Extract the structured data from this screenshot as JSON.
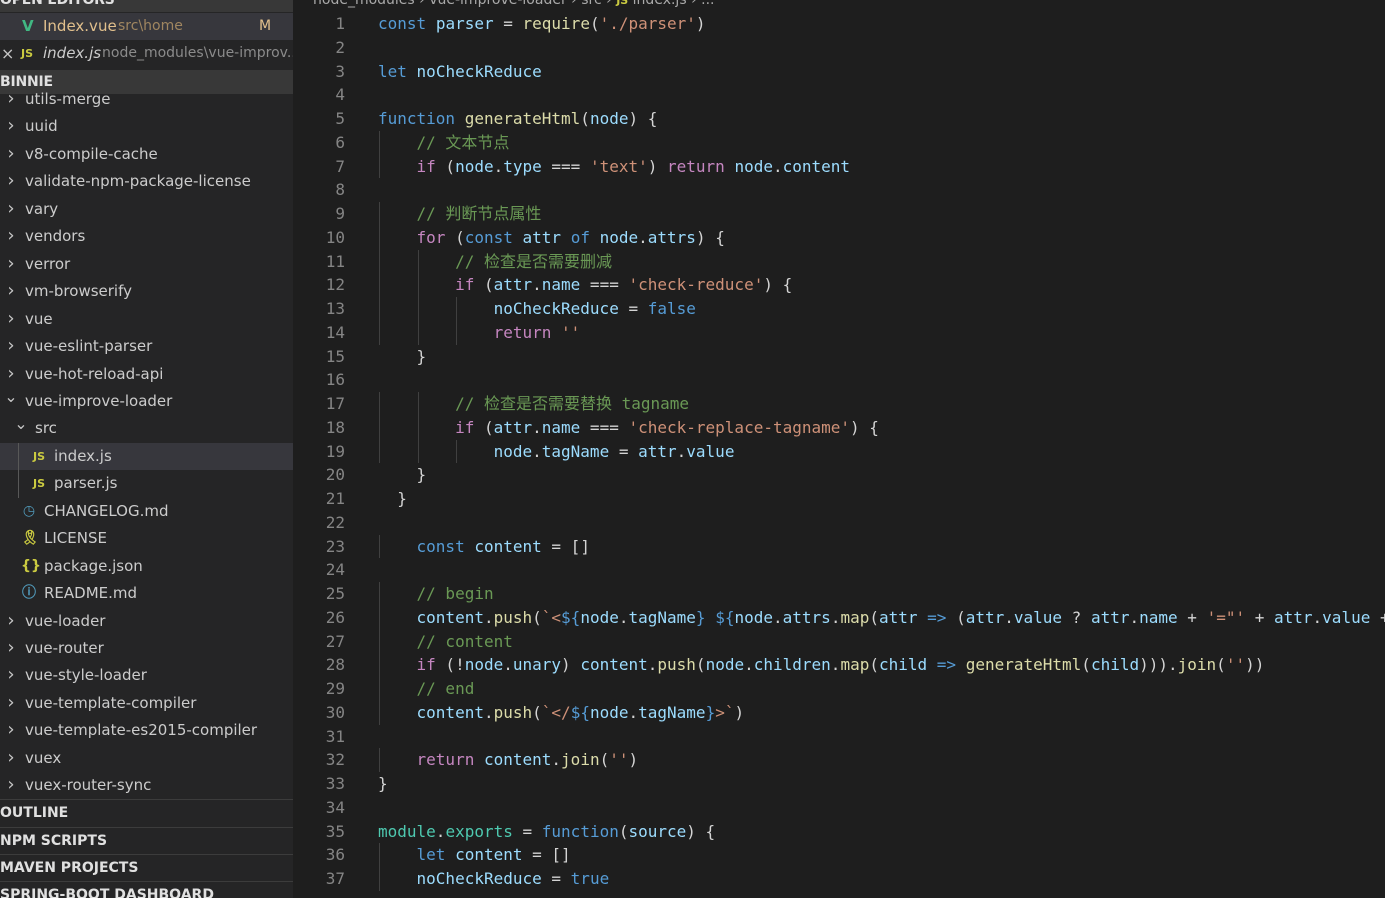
{
  "sidebar": {
    "open_editors_header": "OPEN EDITORS",
    "open_editors": [
      {
        "name": "Index.vue",
        "path": "src\\home",
        "status": "M",
        "icon": "vue-icon"
      },
      {
        "name": "index.js",
        "path": "node_modules\\vue-improv...",
        "icon": "js-icon",
        "close": "×"
      }
    ],
    "explorer_header": "BINNIE",
    "tree": [
      {
        "label": "utils-merge",
        "type": "folder",
        "expanded": false
      },
      {
        "label": "uuid",
        "type": "folder",
        "expanded": false
      },
      {
        "label": "v8-compile-cache",
        "type": "folder",
        "expanded": false
      },
      {
        "label": "validate-npm-package-license",
        "type": "folder",
        "expanded": false
      },
      {
        "label": "vary",
        "type": "folder",
        "expanded": false
      },
      {
        "label": "vendors",
        "type": "folder",
        "expanded": false
      },
      {
        "label": "verror",
        "type": "folder",
        "expanded": false
      },
      {
        "label": "vm-browserify",
        "type": "folder",
        "expanded": false
      },
      {
        "label": "vue",
        "type": "folder",
        "expanded": false
      },
      {
        "label": "vue-eslint-parser",
        "type": "folder",
        "expanded": false
      },
      {
        "label": "vue-hot-reload-api",
        "type": "folder",
        "expanded": false
      },
      {
        "label": "vue-improve-loader",
        "type": "folder",
        "expanded": true
      },
      {
        "label": "src",
        "type": "folder",
        "expanded": true
      },
      {
        "label": "index.js",
        "type": "file",
        "icon": "js-icon",
        "icon_text": "JS",
        "icon_color": "#cbcb41"
      },
      {
        "label": "parser.js",
        "type": "file",
        "icon": "js-icon",
        "icon_text": "JS",
        "icon_color": "#cbcb41"
      },
      {
        "label": "CHANGELOG.md",
        "type": "file",
        "icon": "clock-icon",
        "icon_text": "◷",
        "icon_color": "#519aba"
      },
      {
        "label": "LICENSE",
        "type": "file",
        "icon": "license-icon",
        "icon_text": "🎗",
        "icon_color": "#cbcb41"
      },
      {
        "label": "package.json",
        "type": "file",
        "icon": "braces-icon",
        "icon_text": "{}",
        "icon_color": "#cbcb41"
      },
      {
        "label": "README.md",
        "type": "file",
        "icon": "info-icon",
        "icon_text": "ⓘ",
        "icon_color": "#519aba"
      },
      {
        "label": "vue-loader",
        "type": "folder",
        "expanded": false
      },
      {
        "label": "vue-router",
        "type": "folder",
        "expanded": false
      },
      {
        "label": "vue-style-loader",
        "type": "folder",
        "expanded": false
      },
      {
        "label": "vue-template-compiler",
        "type": "folder",
        "expanded": false
      },
      {
        "label": "vue-template-es2015-compiler",
        "type": "folder",
        "expanded": false
      },
      {
        "label": "vuex",
        "type": "folder",
        "expanded": false
      },
      {
        "label": "vuex-router-sync",
        "type": "folder",
        "expanded": false
      }
    ],
    "panels": [
      "OUTLINE",
      "NPM SCRIPTS",
      "MAVEN PROJECTS",
      "SPRING-BOOT DASHBOARD"
    ]
  },
  "editor": {
    "breadcrumb": [
      "node_modules",
      "vue-improve-loader",
      "src",
      "index.js",
      "..."
    ],
    "lines": [
      [
        [
          "k",
          "const"
        ],
        [
          "p",
          " "
        ],
        [
          "v",
          "parser"
        ],
        [
          "p",
          " = "
        ],
        [
          "f",
          "require"
        ],
        [
          "p",
          "("
        ],
        [
          "s",
          "'./parser'"
        ],
        [
          "p",
          ")"
        ]
      ],
      [],
      [
        [
          "k",
          "let"
        ],
        [
          "p",
          " "
        ],
        [
          "v",
          "noCheckReduce"
        ]
      ],
      [],
      [
        [
          "k",
          "function"
        ],
        [
          "p",
          " "
        ],
        [
          "f",
          "generateHtml"
        ],
        [
          "p",
          "("
        ],
        [
          "v",
          "node"
        ],
        [
          "p",
          ") {"
        ]
      ],
      [
        [
          "p",
          "  "
        ],
        [
          "m",
          "// 文本节点"
        ]
      ],
      [
        [
          "p",
          "  "
        ],
        [
          "c",
          "if"
        ],
        [
          "p",
          " ("
        ],
        [
          "v",
          "node"
        ],
        [
          "p",
          "."
        ],
        [
          "v",
          "type"
        ],
        [
          "p",
          " === "
        ],
        [
          "s",
          "'text'"
        ],
        [
          "p",
          ") "
        ],
        [
          "c",
          "return"
        ],
        [
          "p",
          " "
        ],
        [
          "v",
          "node"
        ],
        [
          "p",
          "."
        ],
        [
          "v",
          "content"
        ]
      ],
      [],
      [
        [
          "p",
          "  "
        ],
        [
          "m",
          "// 判断节点属性"
        ]
      ],
      [
        [
          "p",
          "  "
        ],
        [
          "c",
          "for"
        ],
        [
          "p",
          " ("
        ],
        [
          "k",
          "const"
        ],
        [
          "p",
          " "
        ],
        [
          "v",
          "attr"
        ],
        [
          "p",
          " "
        ],
        [
          "k",
          "of"
        ],
        [
          "p",
          " "
        ],
        [
          "v",
          "node"
        ],
        [
          "p",
          "."
        ],
        [
          "v",
          "attrs"
        ],
        [
          "p",
          ") {"
        ]
      ],
      [
        [
          "p",
          "    "
        ],
        [
          "m",
          "// 检查是否需要删减"
        ]
      ],
      [
        [
          "p",
          "    "
        ],
        [
          "c",
          "if"
        ],
        [
          "p",
          " ("
        ],
        [
          "v",
          "attr"
        ],
        [
          "p",
          "."
        ],
        [
          "v",
          "name"
        ],
        [
          "p",
          " === "
        ],
        [
          "s",
          "'check-reduce'"
        ],
        [
          "p",
          ") {"
        ]
      ],
      [
        [
          "p",
          "      "
        ],
        [
          "v",
          "noCheckReduce"
        ],
        [
          "p",
          " = "
        ],
        [
          "k",
          "false"
        ]
      ],
      [
        [
          "p",
          "      "
        ],
        [
          "c",
          "return"
        ],
        [
          "p",
          " "
        ],
        [
          "s",
          "''"
        ]
      ],
      [
        [
          "p",
          "    }"
        ]
      ],
      [],
      [
        [
          "p",
          "    "
        ],
        [
          "m",
          "// 检查是否需要替换 tagname"
        ]
      ],
      [
        [
          "p",
          "    "
        ],
        [
          "c",
          "if"
        ],
        [
          "p",
          " ("
        ],
        [
          "v",
          "attr"
        ],
        [
          "p",
          "."
        ],
        [
          "v",
          "name"
        ],
        [
          "p",
          " === "
        ],
        [
          "s",
          "'check-replace-tagname'"
        ],
        [
          "p",
          ") {"
        ]
      ],
      [
        [
          "p",
          "      "
        ],
        [
          "v",
          "node"
        ],
        [
          "p",
          "."
        ],
        [
          "v",
          "tagName"
        ],
        [
          "p",
          " = "
        ],
        [
          "v",
          "attr"
        ],
        [
          "p",
          "."
        ],
        [
          "v",
          "value"
        ]
      ],
      [
        [
          "p",
          "    }"
        ]
      ],
      [
        [
          "p",
          "  }"
        ]
      ],
      [],
      [
        [
          "p",
          "  "
        ],
        [
          "k",
          "const"
        ],
        [
          "p",
          " "
        ],
        [
          "v",
          "content"
        ],
        [
          "p",
          " = []"
        ]
      ],
      [],
      [
        [
          "p",
          "  "
        ],
        [
          "m",
          "// begin"
        ]
      ],
      [
        [
          "p",
          "  "
        ],
        [
          "v",
          "content"
        ],
        [
          "p",
          "."
        ],
        [
          "f",
          "push"
        ],
        [
          "p",
          "("
        ],
        [
          "s",
          "`<"
        ],
        [
          "k",
          "${"
        ],
        [
          "v",
          "node"
        ],
        [
          "p",
          "."
        ],
        [
          "v",
          "tagName"
        ],
        [
          "k",
          "}"
        ],
        [
          "s",
          " "
        ],
        [
          "k",
          "${"
        ],
        [
          "v",
          "node"
        ],
        [
          "p",
          "."
        ],
        [
          "v",
          "attrs"
        ],
        [
          "p",
          "."
        ],
        [
          "f",
          "map"
        ],
        [
          "p",
          "("
        ],
        [
          "v",
          "attr"
        ],
        [
          "p",
          " "
        ],
        [
          "k",
          "=>"
        ],
        [
          "p",
          " ("
        ],
        [
          "v",
          "attr"
        ],
        [
          "p",
          "."
        ],
        [
          "v",
          "value"
        ],
        [
          "p",
          " ? "
        ],
        [
          "v",
          "attr"
        ],
        [
          "p",
          "."
        ],
        [
          "v",
          "name"
        ],
        [
          "p",
          " + "
        ],
        [
          "s",
          "'=\"'"
        ],
        [
          "p",
          " + "
        ],
        [
          "v",
          "attr"
        ],
        [
          "p",
          "."
        ],
        [
          "v",
          "value"
        ],
        [
          "p",
          " +"
        ]
      ],
      [
        [
          "p",
          "  "
        ],
        [
          "m",
          "// content"
        ]
      ],
      [
        [
          "p",
          "  "
        ],
        [
          "c",
          "if"
        ],
        [
          "p",
          " (!"
        ],
        [
          "v",
          "node"
        ],
        [
          "p",
          "."
        ],
        [
          "v",
          "unary"
        ],
        [
          "p",
          ") "
        ],
        [
          "v",
          "content"
        ],
        [
          "p",
          "."
        ],
        [
          "f",
          "push"
        ],
        [
          "p",
          "("
        ],
        [
          "v",
          "node"
        ],
        [
          "p",
          "."
        ],
        [
          "v",
          "children"
        ],
        [
          "p",
          "."
        ],
        [
          "f",
          "map"
        ],
        [
          "p",
          "("
        ],
        [
          "v",
          "child"
        ],
        [
          "p",
          " "
        ],
        [
          "k",
          "=>"
        ],
        [
          "p",
          " "
        ],
        [
          "f",
          "generateHtml"
        ],
        [
          "p",
          "("
        ],
        [
          "v",
          "child"
        ],
        [
          "p",
          ")))."
        ],
        [
          "f",
          "join"
        ],
        [
          "p",
          "("
        ],
        [
          "s",
          "''"
        ],
        [
          "p",
          "))"
        ]
      ],
      [
        [
          "p",
          "  "
        ],
        [
          "m",
          "// end"
        ]
      ],
      [
        [
          "p",
          "  "
        ],
        [
          "v",
          "content"
        ],
        [
          "p",
          "."
        ],
        [
          "f",
          "push"
        ],
        [
          "p",
          "("
        ],
        [
          "s",
          "`</"
        ],
        [
          "k",
          "${"
        ],
        [
          "v",
          "node"
        ],
        [
          "p",
          "."
        ],
        [
          "v",
          "tagName"
        ],
        [
          "k",
          "}"
        ],
        [
          "s",
          ">`"
        ],
        [
          "p",
          ")"
        ]
      ],
      [],
      [
        [
          "p",
          "  "
        ],
        [
          "c",
          "return"
        ],
        [
          "p",
          " "
        ],
        [
          "v",
          "content"
        ],
        [
          "p",
          "."
        ],
        [
          "f",
          "join"
        ],
        [
          "p",
          "("
        ],
        [
          "s",
          "''"
        ],
        [
          "p",
          ")"
        ]
      ],
      [
        [
          "p",
          "}"
        ]
      ],
      [],
      [
        [
          "n",
          "module"
        ],
        [
          "p",
          "."
        ],
        [
          "n",
          "exports"
        ],
        [
          "p",
          " = "
        ],
        [
          "k",
          "function"
        ],
        [
          "p",
          "("
        ],
        [
          "v",
          "source"
        ],
        [
          "p",
          ") {"
        ]
      ],
      [
        [
          "p",
          "  "
        ],
        [
          "k",
          "let"
        ],
        [
          "p",
          " "
        ],
        [
          "v",
          "content"
        ],
        [
          "p",
          " = []"
        ]
      ],
      [
        [
          "p",
          "  "
        ],
        [
          "v",
          "noCheckReduce"
        ],
        [
          "p",
          " = "
        ],
        [
          "k",
          "true"
        ]
      ]
    ]
  }
}
